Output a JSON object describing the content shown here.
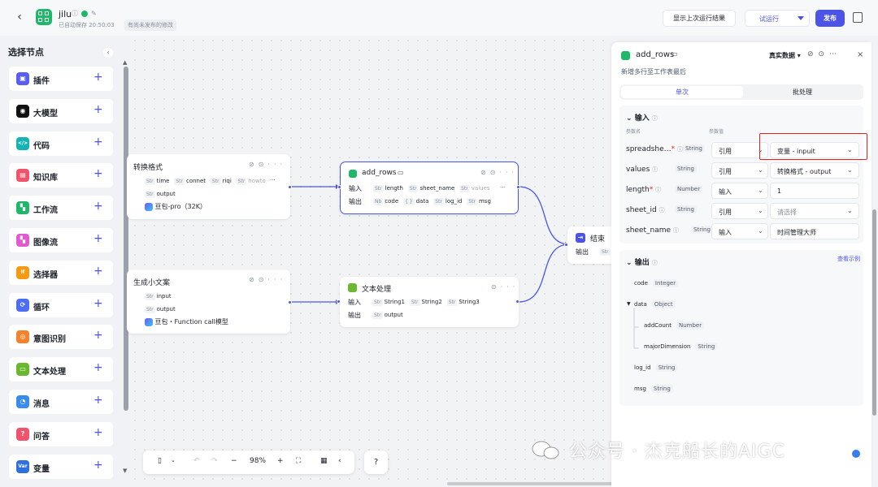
{
  "topbar": {
    "back": "‹",
    "app_title": "jilu",
    "save_status": "已自动保存 20:50:03",
    "unpublished": "有尚未发布的修改",
    "show_last": "显示上次运行结果",
    "trial_run": "试运行",
    "publish": "发布"
  },
  "left": {
    "title": "选择节点",
    "collapse": "‹",
    "nodes": [
      {
        "label": "插件",
        "color": "#5b5ef5",
        "glyph": "▣"
      },
      {
        "label": "大模型",
        "color": "#111111",
        "glyph": "◉"
      },
      {
        "label": "代码",
        "color": "#15b3b3",
        "glyph": "</>"
      },
      {
        "label": "知识库",
        "color": "#f0536b",
        "glyph": "▤"
      },
      {
        "label": "工作流",
        "color": "#1fb86b",
        "glyph": "▚"
      },
      {
        "label": "图像流",
        "color": "#e35ad0",
        "glyph": "▚"
      },
      {
        "label": "选择器",
        "color": "#f59a12",
        "glyph": "If"
      },
      {
        "label": "循环",
        "color": "#4c6ef5",
        "glyph": "⟳"
      },
      {
        "label": "意图识别",
        "color": "#f5822a",
        "glyph": "◎"
      },
      {
        "label": "文本处理",
        "color": "#6ab82f",
        "glyph": "▭"
      },
      {
        "label": "消息",
        "color": "#3a8bf0",
        "glyph": "◔"
      },
      {
        "label": "问答",
        "color": "#f0536b",
        "glyph": "?"
      },
      {
        "label": "变量",
        "color": "#2f6fe0",
        "glyph": "Var"
      }
    ],
    "plus": "+"
  },
  "canvas": {
    "card1": {
      "title": "转换格式",
      "tags": [
        "time",
        "connet",
        "riqi",
        "howto"
      ],
      "tag_type": "Str",
      "output": "output",
      "model": "豆包-pro（32K）"
    },
    "card2": {
      "title": "add_rows",
      "in_label": "输入",
      "out_label": "输出",
      "in_tags": [
        "length",
        "sheet_name",
        "values"
      ],
      "in_types": [
        "Str",
        "Str",
        "Str"
      ],
      "out_tags": [
        "code",
        "data",
        "log_id",
        "msg"
      ],
      "out_types": [
        "Nb",
        "{ }",
        "Str",
        "Str"
      ]
    },
    "card3": {
      "title": "生成小文案",
      "tags": [
        "input",
        "output"
      ],
      "tag_type": "Str",
      "model": "豆包・Function call模型"
    },
    "card4": {
      "title": "文本处理",
      "in_label": "输入",
      "out_label": "输出",
      "in_tags": [
        "String1",
        "String2",
        "String3"
      ],
      "tag_type": "Str",
      "out_tags": [
        "output"
      ]
    },
    "card5": {
      "title": "结束",
      "out_label": "输出",
      "tag_type": "Str"
    },
    "ellipsis": "···"
  },
  "toolbar": {
    "zoom": "98%",
    "minus": "−",
    "plus": "+",
    "help": "?"
  },
  "panel": {
    "title": "add_rows",
    "real_data": "真实数据",
    "close": "×",
    "desc": "新增多行至工作表最后",
    "tab_single": "单次",
    "tab_batch": "批处理",
    "input_header": "输入",
    "col_name": "参数名",
    "col_value": "参数值",
    "inputs": [
      {
        "name": "spreadshe…",
        "required": "*",
        "type": "String",
        "mode": "引用",
        "value": "变量 - inpuit",
        "chevron": "⌄"
      },
      {
        "name": "values",
        "required": "",
        "type": "String",
        "mode": "引用",
        "value": "转换格式 - output",
        "chevron": "⌄"
      },
      {
        "name": "length",
        "required": "*",
        "type": "Number",
        "mode": "输入",
        "value": "1",
        "chevron": ""
      },
      {
        "name": "sheet_id",
        "required": "",
        "type": "String",
        "mode": "引用",
        "value": "请选择",
        "chevron": "⌄"
      },
      {
        "name": "sheet_name",
        "required": "",
        "type": "String",
        "mode": "输入",
        "value": "时间管理大师",
        "chevron": ""
      }
    ],
    "output_header": "输出",
    "view_example": "查看示例",
    "outputs": [
      {
        "name": "code",
        "type": "Integer"
      },
      {
        "name": "data",
        "type": "Object"
      },
      {
        "name": "addCount",
        "type": "Number"
      },
      {
        "name": "majorDimension",
        "type": "String"
      },
      {
        "name": "log_id",
        "type": "String"
      },
      {
        "name": "msg",
        "type": "String"
      }
    ]
  },
  "watermark": "公众号 · 杰克船长的AIGC"
}
